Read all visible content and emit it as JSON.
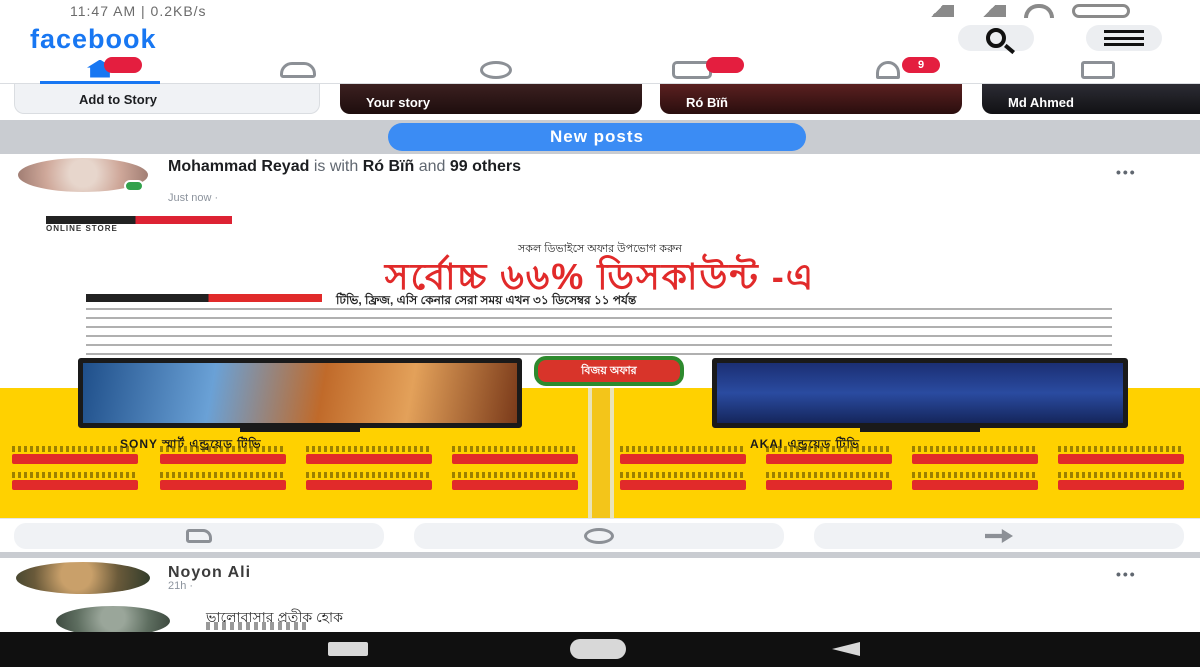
{
  "status_bar": {
    "time": "11:47 AM | 0.2KB/s"
  },
  "header": {
    "logo": "facebook",
    "search_icon": "search-icon",
    "menu_icon": "menu-icon"
  },
  "nav_tabs": [
    {
      "id": "home",
      "icon": "home-icon",
      "badge": ""
    },
    {
      "id": "friends",
      "icon": "friends-icon"
    },
    {
      "id": "messenger",
      "icon": "messenger-icon"
    },
    {
      "id": "watch",
      "icon": "watch-icon",
      "badge": ""
    },
    {
      "id": "notifications",
      "icon": "bell-icon",
      "badge": "9"
    },
    {
      "id": "marketplace",
      "icon": "marketplace-icon"
    }
  ],
  "stories": {
    "add_label": "Add to Story",
    "items": [
      {
        "label": "Your story"
      },
      {
        "label": "Ró Bïñ"
      },
      {
        "label": "Md Ahmed"
      }
    ]
  },
  "new_posts": {
    "label": "New posts"
  },
  "post_1": {
    "author": "Mohammad Reyad",
    "connector": " is with ",
    "tagged": "Ró Bïñ",
    "and_text": " and ",
    "others": "99 others",
    "meta": "Just now · ",
    "more": "•••",
    "ad": {
      "subhead": "সকল ডিভাইসে অফার উপভোগ করুন",
      "headline": "সর্বোচ্চ ৬৬% ডিসকাউন্ট -এ",
      "tagline": "টিভি, ফ্রিজ, এসি কেনার সেরা সময় এখন ৩১ ডিসেম্বর ১১ পর্যন্ত",
      "badge": "বিজয় অফার",
      "caption_left": "SONY স্মার্ট এন্ড্রয়েড টিভি",
      "caption_right": "AKAI এন্ড্রয়েড টিভি",
      "logo_text": "ONLINE STORE"
    },
    "actions": {
      "like": "Like",
      "comment": "Comment",
      "share": "Share"
    }
  },
  "post_2": {
    "author": "Noyon Ali",
    "meta": "21h · ",
    "more": "•••",
    "text": "ভালোবাসার প্রতীক হোক"
  },
  "android_nav": {
    "back_icon": "back-icon",
    "home_icon": "home-pill-icon",
    "recents_icon": "recents-icon"
  },
  "colors": {
    "brand": "#1877f2",
    "badge": "#e41e3f",
    "new_posts": "#3b8cf4",
    "ad_yellow": "#ffd100",
    "ad_red": "#e12a2a"
  }
}
